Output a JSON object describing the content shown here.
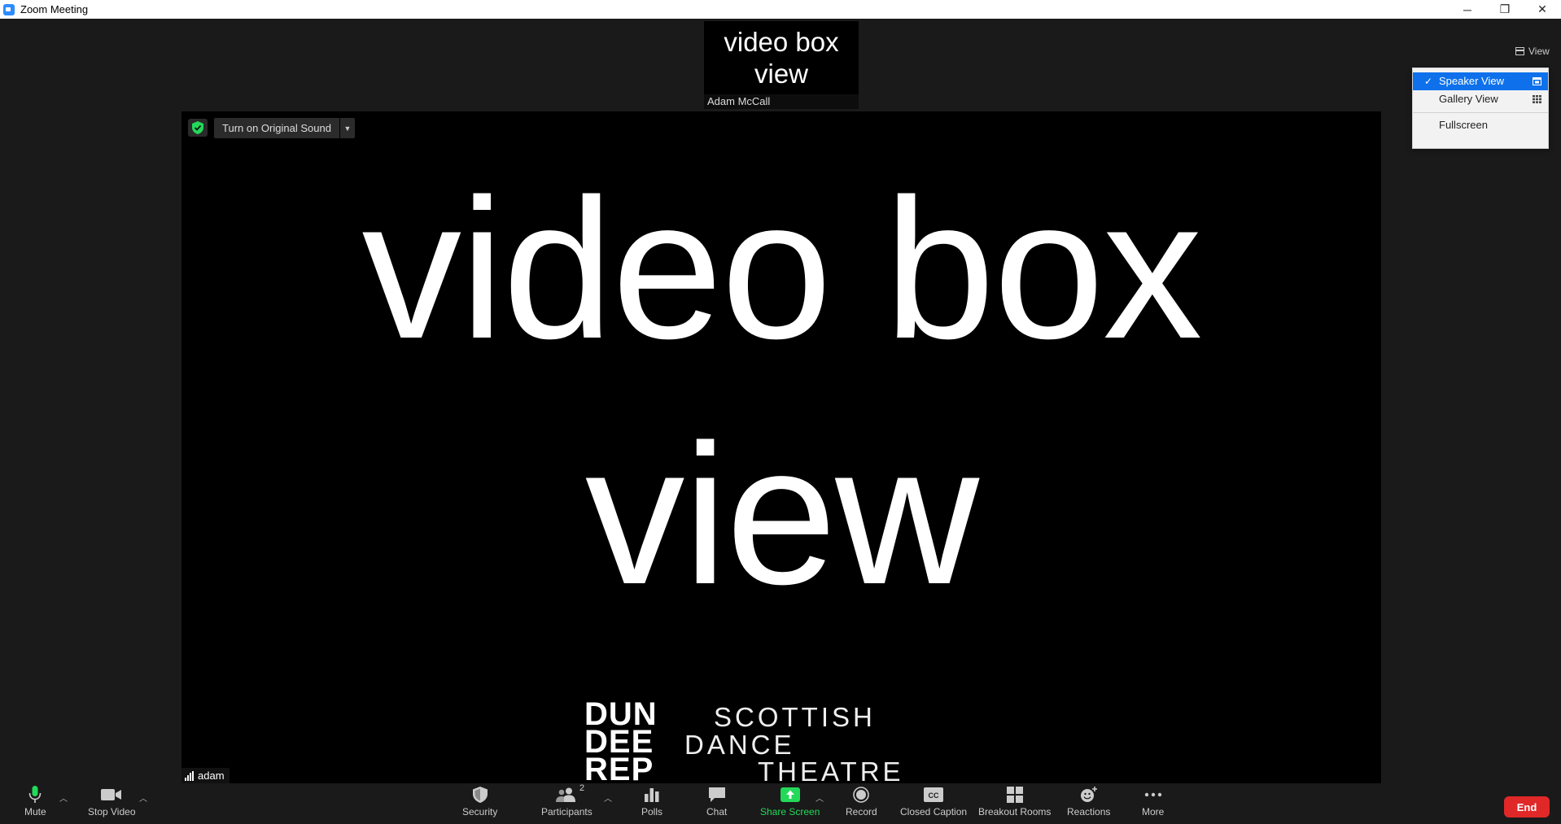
{
  "window": {
    "title": "Zoom Meeting",
    "minimize": "─",
    "maximize": "❐",
    "close": "✕"
  },
  "thumbnail": {
    "text_line1": "video box",
    "text_line2": "view",
    "participant_name": "Adam McCall"
  },
  "main_video": {
    "original_sound_button": "Turn on Original Sound",
    "text_line1": "video box",
    "text_line2": "view",
    "logo_dundee": [
      "DUN",
      "DEE",
      "REP"
    ],
    "logo_sdt": [
      "SCOTTISH",
      "DANCE",
      "THEATRE"
    ],
    "participant_name": "adam"
  },
  "view_button": {
    "label": "View"
  },
  "view_menu": {
    "items": [
      {
        "label": "Speaker View",
        "selected": true,
        "icon": "speaker-view-icon"
      },
      {
        "label": "Gallery View",
        "selected": false,
        "icon": "gallery-view-icon"
      },
      {
        "label": "Fullscreen",
        "selected": false
      }
    ]
  },
  "toolbar": {
    "mute": "Mute",
    "stop_video": "Stop Video",
    "security": "Security",
    "participants": "Participants",
    "participants_count": "2",
    "polls": "Polls",
    "chat": "Chat",
    "share_screen": "Share Screen",
    "record": "Record",
    "closed_caption": "Closed Caption",
    "breakout_rooms": "Breakout Rooms",
    "reactions": "Reactions",
    "more": "More",
    "end": "End"
  },
  "colors": {
    "accent_blue": "#0e71eb",
    "share_green": "#23d959",
    "end_red": "#e02828",
    "mic_green": "#23d959"
  }
}
